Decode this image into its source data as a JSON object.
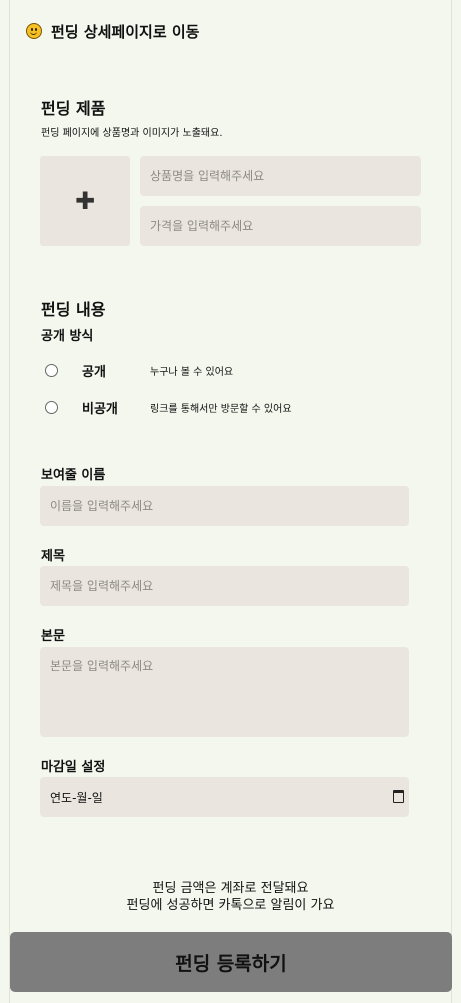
{
  "header": {
    "icon": "smiley-icon",
    "title": "펀딩 상세페이지로 이동"
  },
  "product": {
    "title": "펀딩 제품",
    "description": "펀딩 페이지에 상품명과 이미지가 노출돼요.",
    "add_icon": "plus-icon",
    "name_placeholder": "상품명을 입력해주세요",
    "price_placeholder": "가격을 입력해주세요"
  },
  "content": {
    "title": "펀딩 내용",
    "visibility_label": "공개 방식",
    "options": [
      {
        "label": "공개",
        "description": "누구나 볼 수 있어요"
      },
      {
        "label": "비공개",
        "description": "링크를 통해서만 방문할 수 있어요"
      }
    ]
  },
  "fields": {
    "display_name_label": "보여줄 이름",
    "display_name_placeholder": "이름을 입력해주세요",
    "subject_label": "제목",
    "subject_placeholder": "제목을 입력해주세요",
    "body_label": "본문",
    "body_placeholder": "본문을 입력해주세요",
    "deadline_label": "마감일 설정",
    "deadline_value": "연도-월-일",
    "deadline_icon": "calendar-icon"
  },
  "footer": {
    "note_line1": "펀딩 금액은 계좌로 전달돼요",
    "note_line2": "펀딩에 성공하면 카톡으로 알림이 가요",
    "submit_label": "펀딩 등록하기"
  }
}
